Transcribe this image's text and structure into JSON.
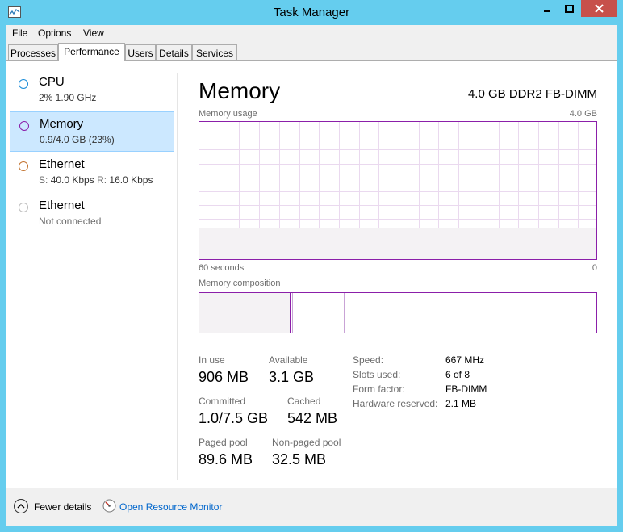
{
  "window": {
    "title": "Task Manager",
    "minimize_label": "—",
    "maximize_label": "☐",
    "close_label": "✕"
  },
  "menu": [
    "File",
    "Options",
    "View"
  ],
  "tabs": [
    "Processes",
    "Performance",
    "Users",
    "Details",
    "Services"
  ],
  "active_tab": "Performance",
  "sidebar": {
    "items": [
      {
        "name": "CPU",
        "sub": "2%  1.90 GHz",
        "color": "#1a8cd8"
      },
      {
        "name": "Memory",
        "sub": "0.9/4.0 GB (23%)",
        "color": "#8b1fa9",
        "selected": true
      },
      {
        "name": "Ethernet",
        "sub_s_label": "S:",
        "sub_s": "40.0 Kbps",
        "sub_r_label": "R:",
        "sub_r": "16.0 Kbps",
        "color": "#c27330"
      },
      {
        "name": "Ethernet",
        "sub": "Not connected",
        "color": "#bdbdbd"
      }
    ]
  },
  "memory": {
    "title": "Memory",
    "model": "4.0 GB DDR2 FB-DIMM",
    "usage_label": "Memory usage",
    "usage_max": "4.0 GB",
    "time_label": "60 seconds",
    "zero_label": "0",
    "usage_fraction": 0.23,
    "composition_label": "Memory composition",
    "composition": {
      "in_use_fraction": 0.23,
      "modified_fraction": 0.005,
      "standby_fraction": 0.13
    },
    "stats": {
      "in_use_label": "In use",
      "in_use": "906 MB",
      "available_label": "Available",
      "available": "3.1 GB",
      "committed_label": "Committed",
      "committed": "1.0/7.5 GB",
      "cached_label": "Cached",
      "cached": "542 MB",
      "paged_label": "Paged pool",
      "paged": "89.6 MB",
      "nonpaged_label": "Non-paged pool",
      "nonpaged": "32.5 MB"
    },
    "details": [
      {
        "key": "Speed:",
        "value": "667 MHz"
      },
      {
        "key": "Slots used:",
        "value": "6 of 8"
      },
      {
        "key": "Form factor:",
        "value": "FB-DIMM"
      },
      {
        "key": "Hardware reserved:",
        "value": "2.1 MB"
      }
    ]
  },
  "footer": {
    "fewer_details": "Fewer details",
    "open_resource_monitor": "Open Resource Monitor"
  },
  "colors": {
    "memory_accent": "#8b1fa9",
    "titlebar": "#65cdee",
    "close": "#c7504b",
    "link": "#0066cc"
  }
}
